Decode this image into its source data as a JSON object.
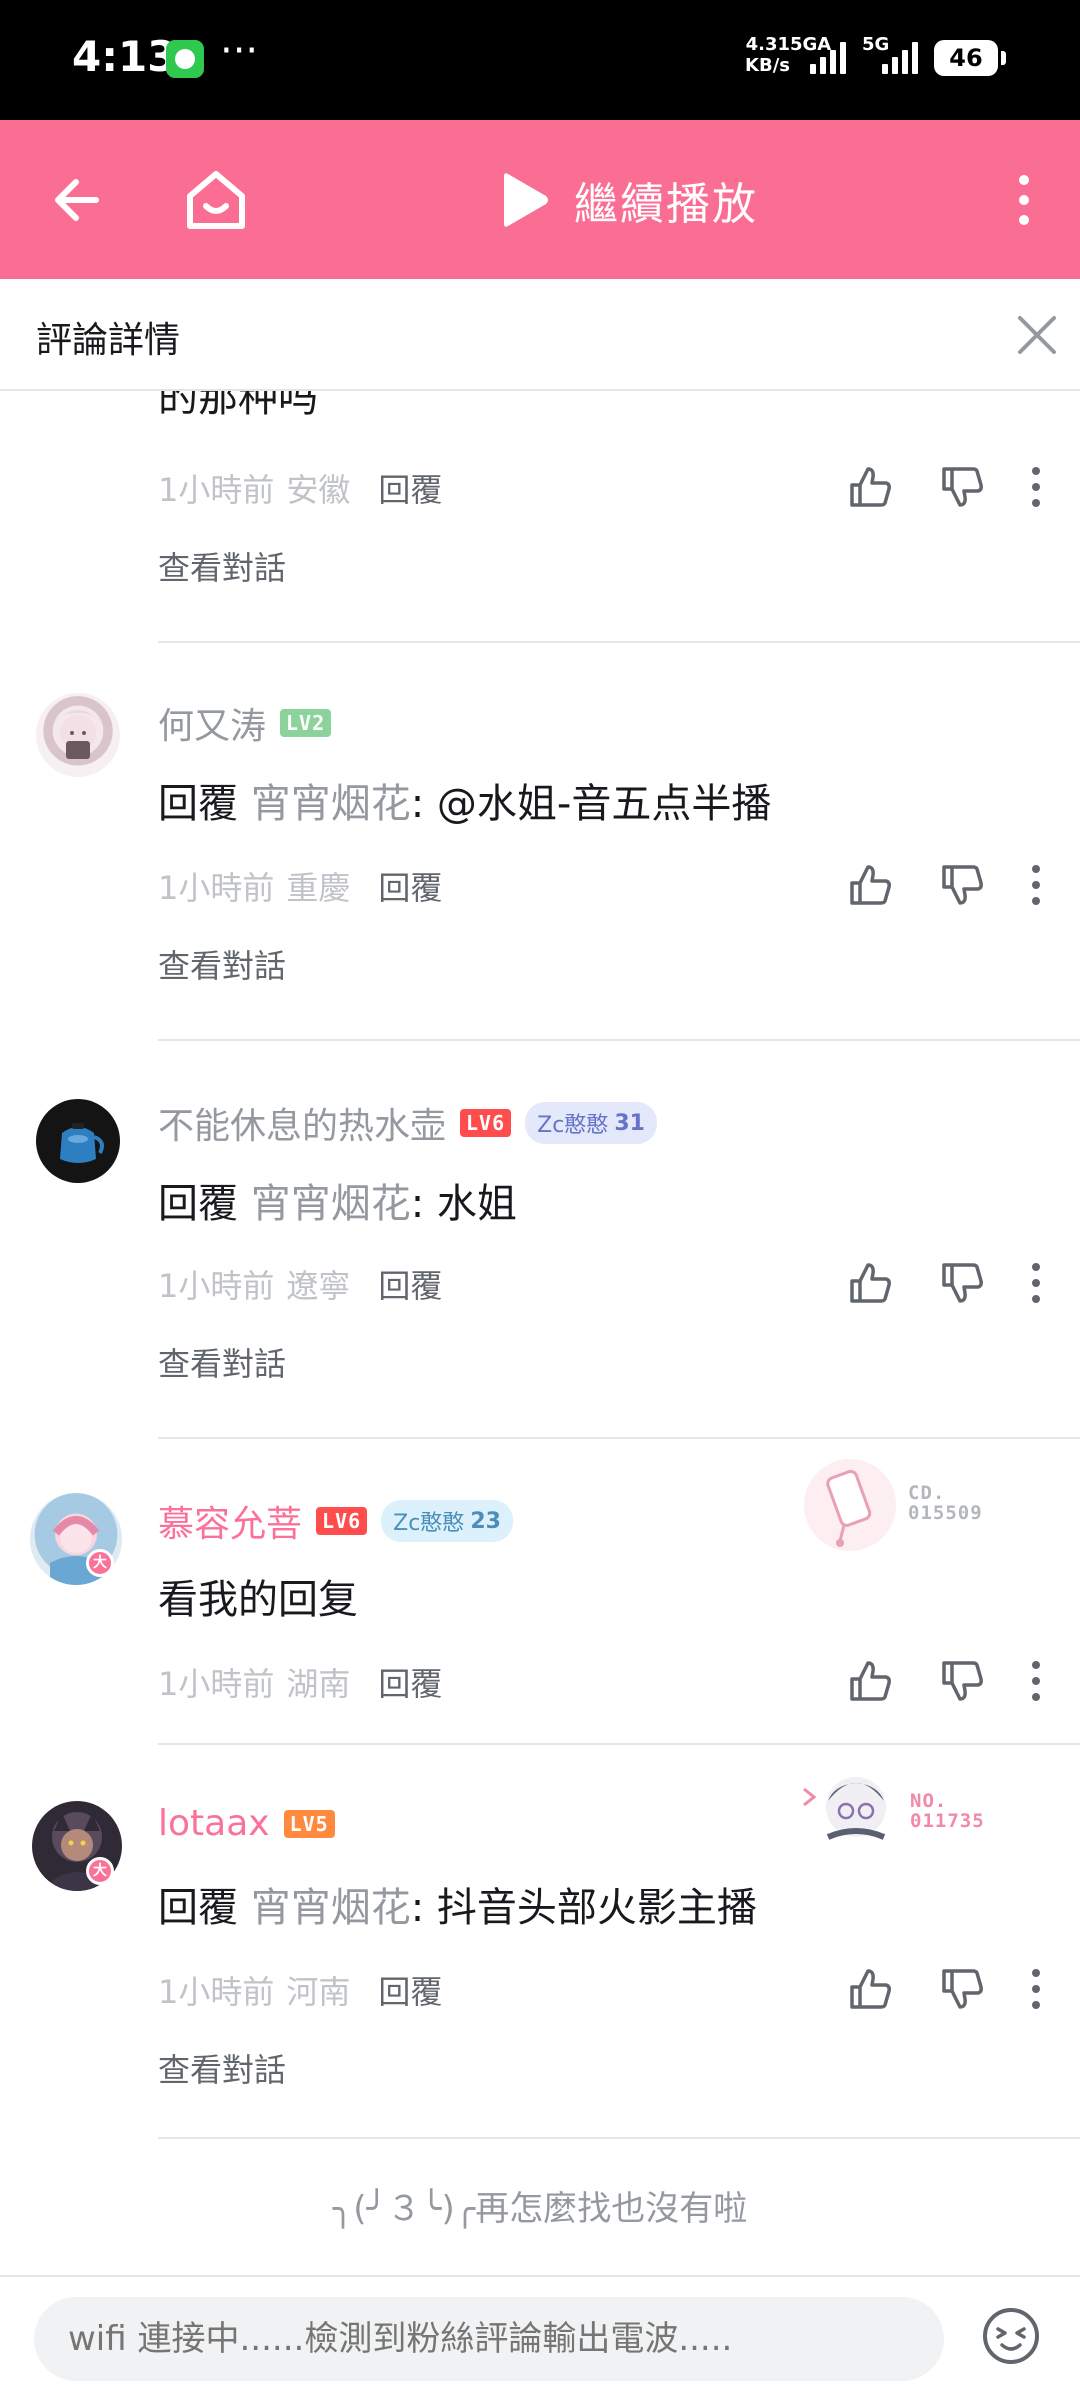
{
  "status_bar": {
    "time": "4:13",
    "dots": "···",
    "speed_value": "4.31",
    "speed_unit": "KB/s",
    "network1": "5GA",
    "network2": "5G",
    "battery": "46"
  },
  "topbar": {
    "play_label": "繼續播放",
    "accent_color": "#fb6e93"
  },
  "detail": {
    "title": "評論詳情"
  },
  "partial_comment": {
    "text": "的那种吗",
    "time": "1小時前",
    "location": "安徽",
    "reply_label": "回覆",
    "view_conversation": "查看對話"
  },
  "comments": [
    {
      "username": "何又涛",
      "level": "LV2",
      "reply_prefix": "回覆",
      "reply_to": "宵宵烟花",
      "text": ": @水姐-音五点半播",
      "time": "1小時前",
      "location": "重慶",
      "reply_label": "回覆",
      "view_conversation": "查看對話"
    },
    {
      "username": "不能休息的热水壶",
      "level": "LV6",
      "fan_badge_name": "Zc憨憨",
      "fan_badge_level": "31",
      "reply_prefix": "回覆",
      "reply_to": "宵宵烟花",
      "text": ": 水姐",
      "time": "1小時前",
      "location": "遼寧",
      "reply_label": "回覆",
      "view_conversation": "查看對話"
    },
    {
      "username": "慕容允菩",
      "level": "LV6",
      "fan_badge_name": "Zc憨憨",
      "fan_badge_level": "23",
      "vip_mark": "大",
      "decor_label": "CD.",
      "decor_number": "015509",
      "text": "看我的回复",
      "time": "1小時前",
      "location": "湖南",
      "reply_label": "回覆"
    },
    {
      "username": "lotaax",
      "level": "LV5",
      "vip_mark": "大",
      "decor_label": "NO.",
      "decor_number": "011735",
      "reply_prefix": "回覆",
      "reply_to": "宵宵烟花",
      "text": ": 抖音头部火影主播",
      "time": "1小時前",
      "location": "河南",
      "reply_label": "回覆",
      "view_conversation": "查看對話"
    }
  ],
  "end_hint": "╮(╯３╰)╭再怎麼找也沒有啦",
  "input": {
    "placeholder": "wifi 連接中......檢測到粉絲評論輸出電波....."
  }
}
